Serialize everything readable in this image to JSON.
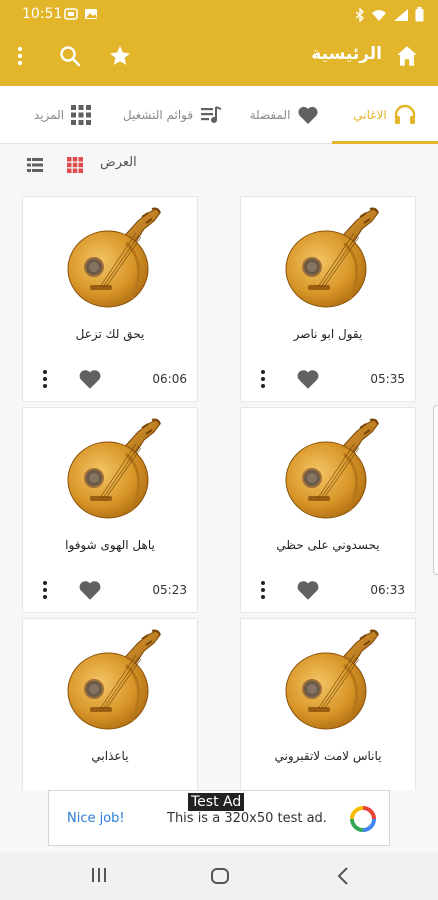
{
  "status_bar": {
    "time": "10:51"
  },
  "app_bar": {
    "title": "الرئيسية"
  },
  "tabs": [
    {
      "label": "الاغاني",
      "icon": "headphones-icon",
      "active": true
    },
    {
      "label": "المفضلة",
      "icon": "heart-icon",
      "active": false
    },
    {
      "label": "قوائم التشغيل",
      "icon": "playlist-icon",
      "active": false
    },
    {
      "label": "المزيد",
      "icon": "grid-icon",
      "active": false
    }
  ],
  "view": {
    "label": "العرض"
  },
  "songs": [
    {
      "title": "يقول ابو ناصر",
      "duration": "05:35"
    },
    {
      "title": "يحق لك تزعل",
      "duration": "06:06"
    },
    {
      "title": "يحسدوني على حظي",
      "duration": "06:33"
    },
    {
      "title": "ياهل الهوى شوفوا",
      "duration": "05:23"
    },
    {
      "title": "ياناس لامت لاتقبروني",
      "duration": ""
    },
    {
      "title": "ياعذابي",
      "duration": ""
    }
  ],
  "ad": {
    "tag": "Test Ad",
    "nice": "Nice job!",
    "text": "This is a 320x50 test ad."
  },
  "colors": {
    "accent": "#e2b52a",
    "icon_gray": "#616161"
  }
}
